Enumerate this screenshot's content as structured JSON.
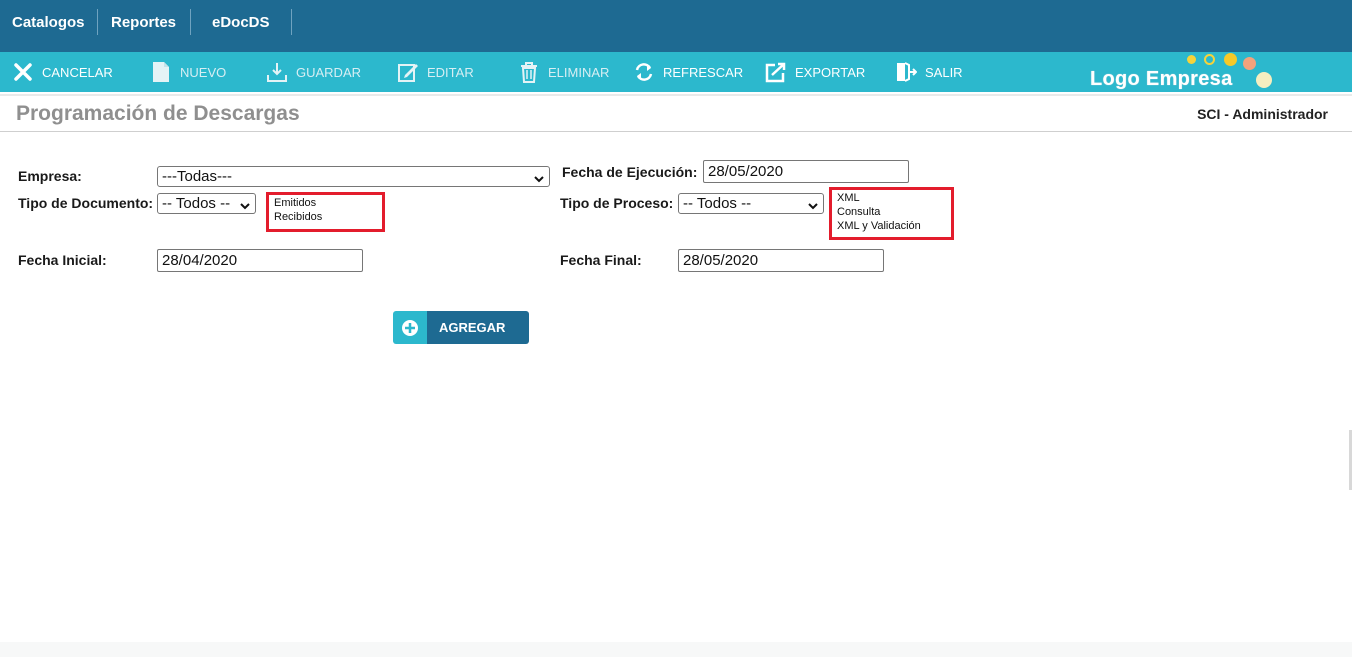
{
  "nav": {
    "items": [
      "Catalogos",
      "Reportes",
      "eDocDS"
    ]
  },
  "toolbar": {
    "cancelar": "CANCELAR",
    "nuevo": "NUEVO",
    "guardar": "GUARDAR",
    "editar": "EDITAR",
    "eliminar": "ELIMINAR",
    "refrescar": "REFRESCAR",
    "exportar": "EXPORTAR",
    "salir": "SALIR"
  },
  "logo": {
    "text": "Logo Empresa"
  },
  "header": {
    "title": "Programación de Descargas",
    "user": "SCI - Administrador"
  },
  "form": {
    "empresa": {
      "label": "Empresa:",
      "value": "---Todas---"
    },
    "fecha_ejecucion": {
      "label": "Fecha de Ejecución:",
      "value": "28/05/2020"
    },
    "tipo_documento": {
      "label": "Tipo de Documento:",
      "value": "-- Todos --",
      "options": [
        "Emitidos",
        "Recibidos"
      ]
    },
    "tipo_proceso": {
      "label": "Tipo de Proceso:",
      "value": "-- Todos --",
      "options": [
        "XML",
        "Consulta",
        "XML y Validación"
      ]
    },
    "fecha_inicial": {
      "label": "Fecha Inicial:",
      "value": "28/04/2020"
    },
    "fecha_final": {
      "label": "Fecha Final:",
      "value": "28/05/2020"
    },
    "agregar": "AGREGAR"
  },
  "colors": {
    "nav_bg": "#1e6a92",
    "toolbar_bg": "#2cb8cd",
    "highlight": "#e31c2c"
  },
  "icons": [
    "close-icon",
    "document-icon",
    "save-icon",
    "edit-icon",
    "trash-icon",
    "refresh-icon",
    "export-icon",
    "exit-icon",
    "add-circle-icon",
    "chevron-down-icon"
  ]
}
